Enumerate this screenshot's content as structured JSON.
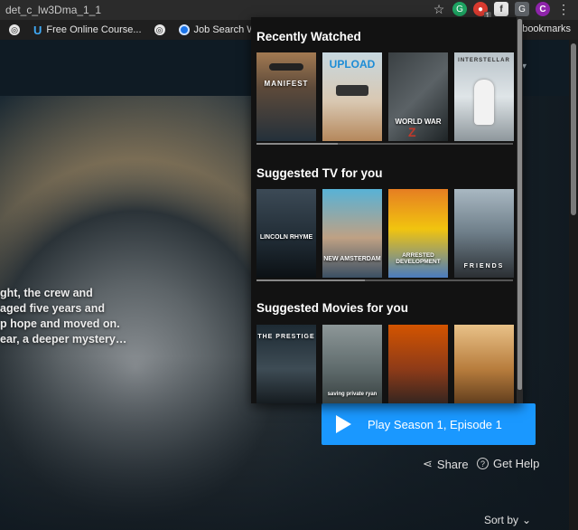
{
  "browser": {
    "url_text": "det_c_lw3Dma_1_1",
    "extension_badge": "1",
    "avatar_letter": "C",
    "bookmarks": [
      {
        "label": "",
        "icon": "globe-icon"
      },
      {
        "label": "Free Online Course...",
        "icon": "udacity-icon"
      },
      {
        "label": "",
        "icon": "globe-icon"
      },
      {
        "label": "Job Search Welcome",
        "icon": "job-icon"
      },
      {
        "label": "",
        "icon": "purple-icon"
      }
    ],
    "bookmarks_right": "er bookmarks"
  },
  "hero": {
    "synopsis_lines": [
      "ght, the crew and",
      "aged five years and",
      "p hope and moved on.",
      "ear, a deeper mystery…"
    ]
  },
  "panel": {
    "sections": [
      {
        "title": "Recently Watched",
        "items": [
          {
            "title": "MANIFEST",
            "art": "manifest"
          },
          {
            "title": "UPLOAD",
            "art": "upload"
          },
          {
            "title": "WORLD WAR",
            "art": "wwz"
          },
          {
            "title": "INTERSTELLAR",
            "art": "interstellar"
          }
        ]
      },
      {
        "title": "Suggested TV for you",
        "items": [
          {
            "title": "LINCOLN RHYME",
            "art": "lincoln"
          },
          {
            "title": "NEW AMSTERDAM",
            "art": "newams"
          },
          {
            "title": "ARRESTED DEVELOPMENT",
            "art": "arrested"
          },
          {
            "title": "FRIENDS",
            "art": "friends"
          }
        ]
      },
      {
        "title": "Suggested Movies for you",
        "items": [
          {
            "title": "THE PRESTIGE",
            "art": "prestige"
          },
          {
            "title": "saving private ryan",
            "art": "ryan"
          },
          {
            "title": "",
            "art": "brave"
          },
          {
            "title": "",
            "art": "indy"
          }
        ]
      }
    ]
  },
  "actions": {
    "play_label": "Play Season 1, Episode 1",
    "share_label": "Share",
    "help_label": "Get Help",
    "sort_label": "Sort by"
  },
  "colors": {
    "play_button": "#1a98ff",
    "background": "#0f171e",
    "panel": "#121212"
  }
}
